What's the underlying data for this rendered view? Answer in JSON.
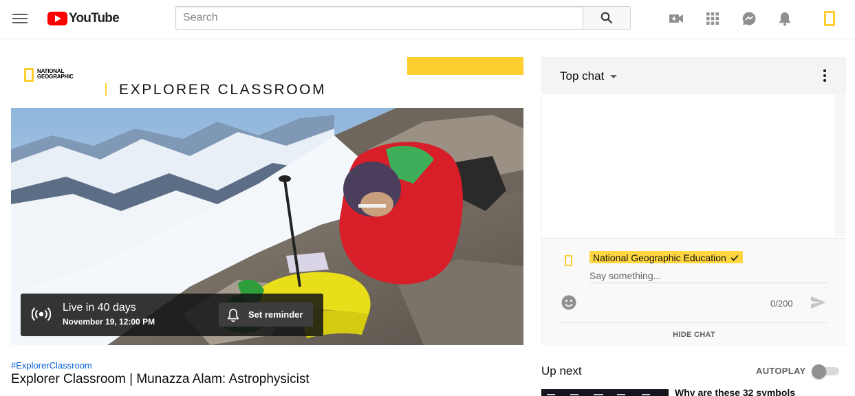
{
  "masthead": {
    "logo_text": "YouTube",
    "search_placeholder": "Search",
    "icons": [
      "menu-icon",
      "search-icon",
      "video-camera-add-icon",
      "apps-grid-icon",
      "messages-icon",
      "bell-icon",
      "national-geographic-avatar-icon"
    ]
  },
  "colors": {
    "brand_red": "#ff0000",
    "natgeo_yellow": "#ffce31",
    "link_blue": "#065fd4"
  },
  "player": {
    "brand_logo_text": [
      "NATIONAL",
      "GEOGRAPHIC"
    ],
    "series_title": "EXPLORER CLASSROOM",
    "live_status": "Live in 40 days",
    "scheduled_time": "November 19, 12:00 PM",
    "reminder_label": "Set reminder"
  },
  "video": {
    "hashtag": "#ExplorerClassroom",
    "title": "Explorer Classroom | Munazza Alam: Astrophysicist"
  },
  "chat": {
    "mode": "Top chat",
    "author_name": "National Geographic Education",
    "input_placeholder": "Say something...",
    "char_count": "0/200",
    "hide_label": "HIDE CHAT"
  },
  "upnext": {
    "label": "Up next",
    "autoplay_label": "AUTOPLAY",
    "autoplay_on": false,
    "first_video_title": "Why are these 32 symbols"
  }
}
